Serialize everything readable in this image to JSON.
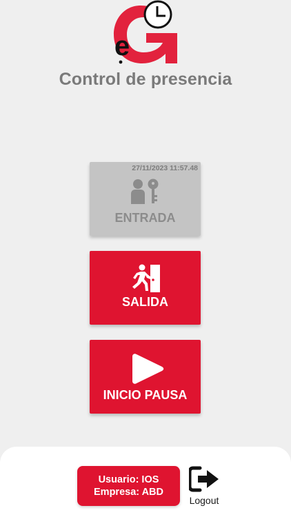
{
  "app": {
    "title": "Control de presencia",
    "logo_icon": "eg-logo-clock-icon",
    "accent_color": "#df1430"
  },
  "actions": {
    "entrada": {
      "timestamp": "27/11/2023 11:57.48",
      "label": "ENTRADA",
      "icon": "person-key-icon",
      "state": "disabled"
    },
    "salida": {
      "label": "SALIDA",
      "icon": "exit-running-person-icon"
    },
    "pausa": {
      "label": "INICIO PAUSA",
      "icon": "play-icon"
    }
  },
  "footer": {
    "user_line": "Usuario: IOS",
    "company_line": "Empresa: ABD",
    "logout_label": "Logout",
    "logout_icon": "logout-icon"
  }
}
